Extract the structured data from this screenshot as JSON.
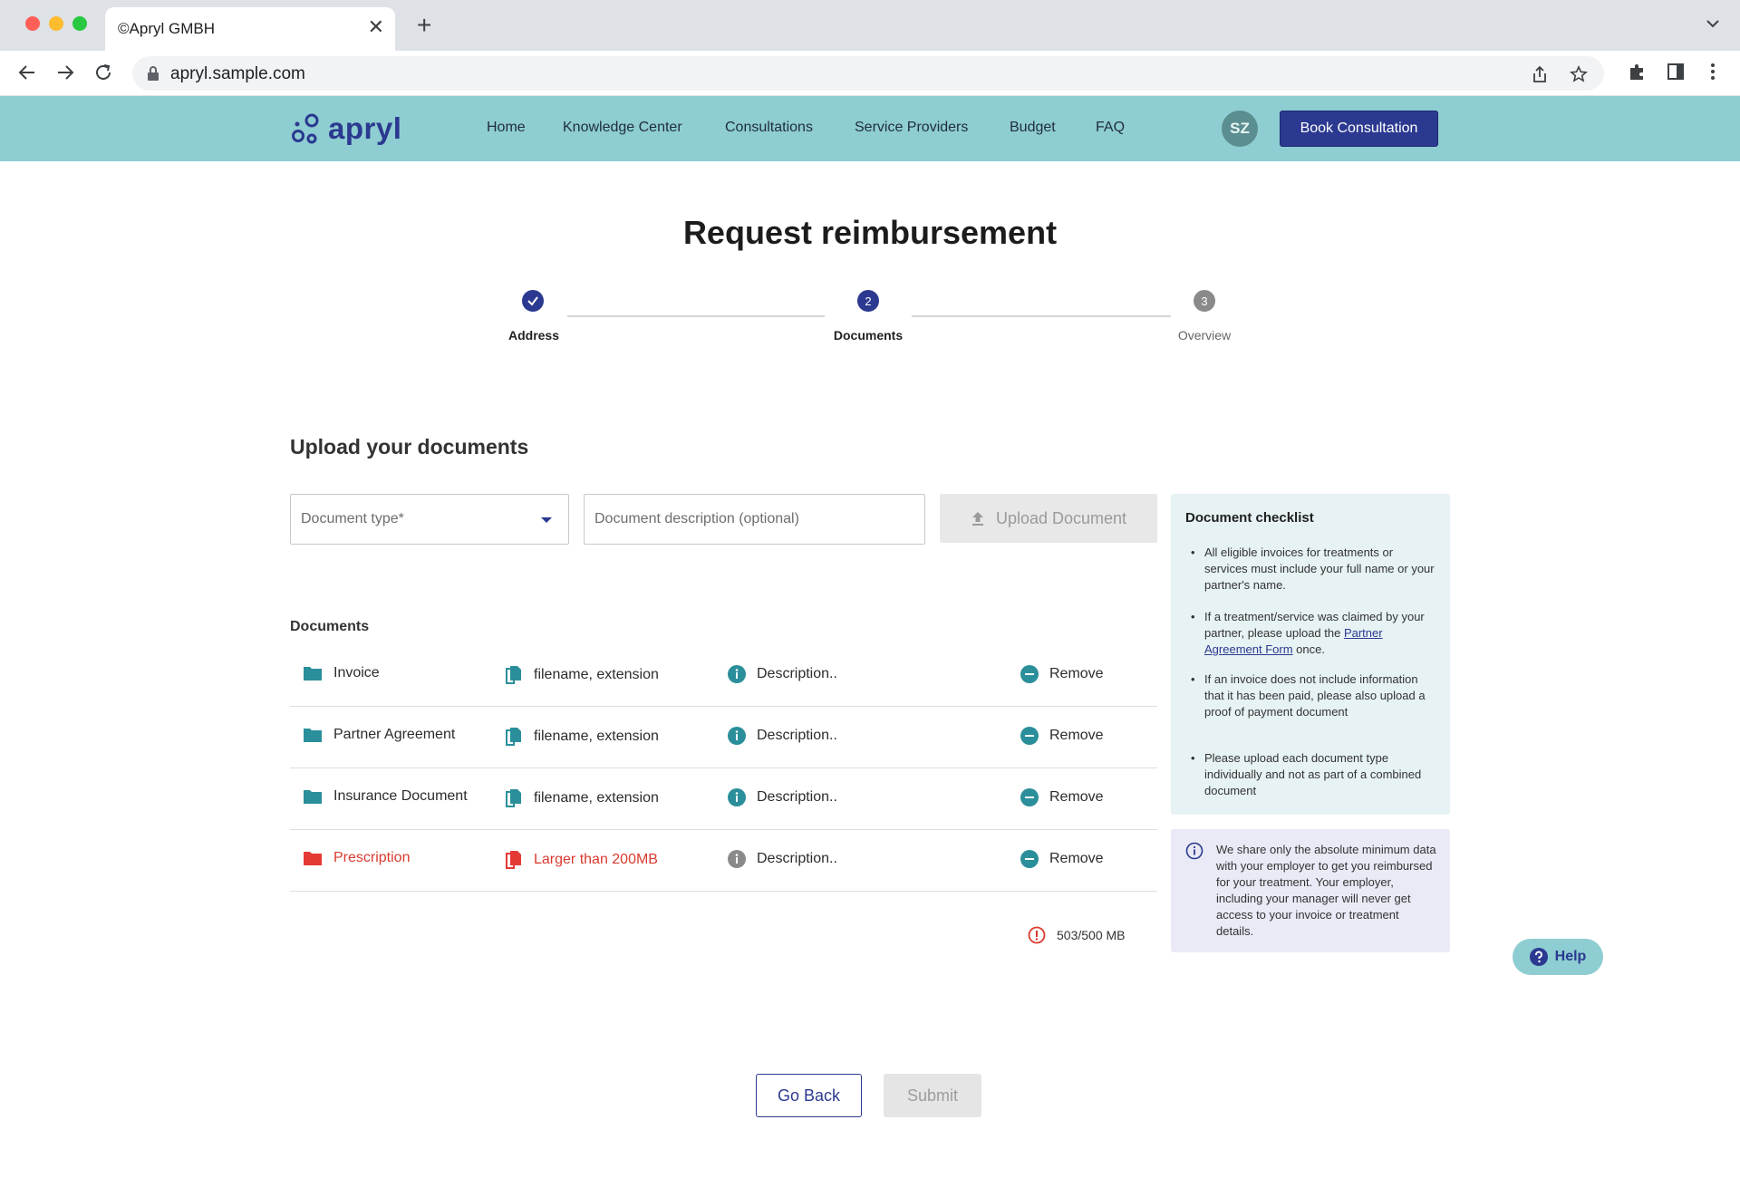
{
  "browser": {
    "tab_title": "©Apryl GMBH",
    "tab_close": "✕",
    "new_tab": "+",
    "url": "apryl.sample.com"
  },
  "site": {
    "brand": "apryl",
    "nav": [
      "Home",
      "Knowledge Center",
      "Consultations",
      "Service Providers",
      "Budget",
      "FAQ"
    ],
    "avatar_initials": "SZ",
    "book_label": "Book Consultation"
  },
  "page": {
    "title": "Request reimbursement",
    "steps": [
      {
        "label": "Address",
        "number": "",
        "state": "done"
      },
      {
        "label": "Documents",
        "number": "2",
        "state": "active"
      },
      {
        "label": "Overview",
        "number": "3",
        "state": "pending"
      }
    ],
    "section_title": "Upload your documents",
    "form": {
      "document_type_placeholder": "Document type*",
      "description_placeholder": "Document description (optional)",
      "upload_label": "Upload Document"
    },
    "documents_title": "Documents",
    "documents": [
      {
        "type": "Invoice",
        "file": "filename, extension",
        "description": "Description..",
        "remove": "Remove",
        "error": false
      },
      {
        "type": "Partner Agreement",
        "file": "filename, extension",
        "description": "Description..",
        "remove": "Remove",
        "error": false
      },
      {
        "type": "Insurance Document",
        "file": "filename, extension",
        "description": "Description..",
        "remove": "Remove",
        "error": false
      },
      {
        "type": "Prescription",
        "file": "Larger than 200MB",
        "description": "Description..",
        "remove": "Remove",
        "error": true
      }
    ],
    "size_usage": "503/500 MB",
    "checklist": {
      "title": "Document checklist",
      "item1": "All eligible invoices for treatments or services must include your full name or your partner's name.",
      "item2_before": "If a treatment/service was claimed by your partner, please upload the ",
      "item2_link": "Partner Agreement Form",
      "item2_after": " once.",
      "item3": "If an invoice does not include information that it has been paid, please also upload a proof of payment document",
      "item4": "Please upload each document type individually and not as part of a combined document"
    },
    "privacy_note": "We share only the absolute minimum data with your employer to get you reimbursed for your treatment. Your employer, including your manager will never get access to your invoice or treatment details.",
    "help_label": "Help",
    "go_back_label": "Go Back",
    "submit_label": "Submit"
  },
  "colors": {
    "brand_navy": "#2b3990",
    "header_teal": "#8ecdd1",
    "icon_teal": "#2a8f9a",
    "error_red": "#d93a2f"
  }
}
